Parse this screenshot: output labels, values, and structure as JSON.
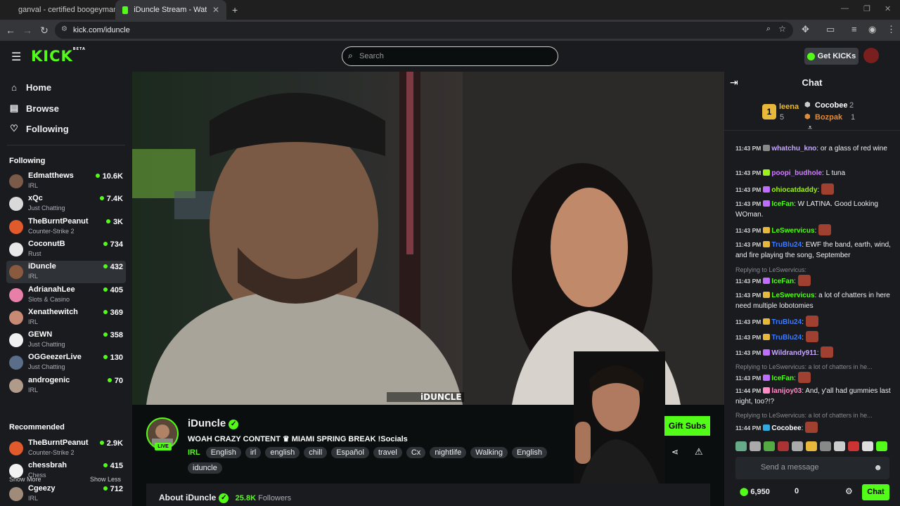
{
  "browser": {
    "tabs": [
      {
        "title": "ganval - certified boogeyman"
      },
      {
        "title": "iDuncle Stream - Watch Live"
      }
    ],
    "url": "kick.com/iduncle"
  },
  "header": {
    "logo": "KICK",
    "logo_badge": "BETA",
    "search_placeholder": "Search",
    "get_kicks": "Get KICKs"
  },
  "sidebar": {
    "nav": [
      {
        "label": "Home",
        "icon": "home-icon"
      },
      {
        "label": "Browse",
        "icon": "browse-icon"
      },
      {
        "label": "Following",
        "icon": "heart-icon"
      }
    ],
    "following_title": "Following",
    "following": [
      {
        "name": "Edmatthews",
        "category": "IRL",
        "viewers": "10.6K",
        "color": "#7b5a4a"
      },
      {
        "name": "xQc",
        "category": "Just Chatting",
        "viewers": "7.4K",
        "color": "#d9d9d9"
      },
      {
        "name": "TheBurntPeanut",
        "category": "Counter-Strike 2",
        "viewers": "3K",
        "color": "#e05a2b"
      },
      {
        "name": "CoconutB",
        "category": "Rust",
        "viewers": "734",
        "color": "#e8e8e8"
      },
      {
        "name": "iDuncle",
        "category": "IRL",
        "viewers": "432",
        "color": "#8a5a3f"
      },
      {
        "name": "AdrianahLee",
        "category": "Slots & Casino",
        "viewers": "405",
        "color": "#e87fa8"
      },
      {
        "name": "Xenathewitch",
        "category": "IRL",
        "viewers": "369",
        "color": "#c98a74"
      },
      {
        "name": "GEWN",
        "category": "Just Chatting",
        "viewers": "358",
        "color": "#f0f0f0"
      },
      {
        "name": "OGGeezerLive",
        "category": "Just Chatting",
        "viewers": "130",
        "color": "#5a6e8a"
      },
      {
        "name": "androgenic",
        "category": "IRL",
        "viewers": "70",
        "color": "#b09a8a"
      }
    ],
    "show_more": "Show More",
    "show_less": "Show Less",
    "recommended_title": "Recommended",
    "recommended": [
      {
        "name": "TheBurntPeanut",
        "category": "Counter-Strike 2",
        "viewers": "2.9K",
        "color": "#e05a2b"
      },
      {
        "name": "chessbrah",
        "category": "Chess",
        "viewers": "415",
        "color": "#f2f2f2"
      },
      {
        "name": "Cgeezy",
        "category": "IRL",
        "viewers": "712",
        "color": "#a08a7a"
      }
    ]
  },
  "video": {
    "overlay_text": "iDUNCLE"
  },
  "stream": {
    "name": "iDuncle",
    "live": "LIVE",
    "title": "WOAH CRAZY CONTENT ♛ MIAMI SPRING BREAK !Socials",
    "category": "IRL",
    "tags": [
      "English",
      "irl",
      "english",
      "chill",
      "Español",
      "travel",
      "Cx",
      "nightlife",
      "Walking",
      "English",
      "iduncle"
    ],
    "gift_subs": "Gift Subs",
    "about": "About iDuncle",
    "followers": "25.8K",
    "followers_label": "Followers"
  },
  "chat": {
    "title": "Chat",
    "leaderboard": {
      "first": {
        "name": "leena",
        "count": "5"
      },
      "second": {
        "name": "Cocobee",
        "count": "2"
      },
      "third": {
        "name": "Bozpak",
        "count": "1"
      }
    },
    "messages": [
      {
        "time": "11:43 PM",
        "user": "whatchu_kno",
        "color": "#c6a6ff",
        "text": "or a glass of red wine"
      },
      {
        "time": "11:43 PM",
        "user": "poopi_budhole",
        "color": "#d17fff",
        "text": "L tuna"
      },
      {
        "time": "11:43 PM",
        "user": "ohiocatdaddy",
        "color": "#9ef01a",
        "text": ""
      },
      {
        "time": "11:43 PM",
        "user": "IceFan",
        "color": "#53fc18",
        "text": "W LATINA. Good Looking WOman."
      },
      {
        "time": "11:43 PM",
        "user": "LeSwervicus",
        "color": "#53fc18",
        "text": ""
      },
      {
        "time": "11:43 PM",
        "user": "TruBlu24",
        "color": "#3d7bff",
        "text": "EWF the band, earth, wind, and fire playing the song, September"
      },
      {
        "time": "11:43 PM",
        "user": "IceFan",
        "color": "#53fc18",
        "text": "",
        "reply": "Replying to LeSwervicus:"
      },
      {
        "time": "11:43 PM",
        "user": "LeSwervicus",
        "color": "#53fc18",
        "text": "a lot of chatters in here need multiple lobotomies"
      },
      {
        "time": "11:43 PM",
        "user": "TruBlu24",
        "color": "#3d7bff",
        "text": ""
      },
      {
        "time": "11:43 PM",
        "user": "TruBlu24",
        "color": "#3d7bff",
        "text": ""
      },
      {
        "time": "11:43 PM",
        "user": "Wildrandy911",
        "color": "#c6a6ff",
        "text": ""
      },
      {
        "time": "11:43 PM",
        "user": "IceFan",
        "color": "#53fc18",
        "text": "",
        "reply": "Replying to LeSwervicus: a lot of chatters in he..."
      },
      {
        "time": "11:44 PM",
        "user": "lanijoy03",
        "color": "#ff8cc6",
        "text": "And, y'all had gummies last night, too?!?"
      },
      {
        "time": "11:44 PM",
        "user": "Cocobee",
        "color": "#ffffff",
        "text": "",
        "reply": "Replying to LeSwervicus: a lot of chatters in he..."
      }
    ],
    "input_placeholder": "Send a message",
    "points": "6,950",
    "kicks": "0",
    "send_label": "Chat"
  }
}
